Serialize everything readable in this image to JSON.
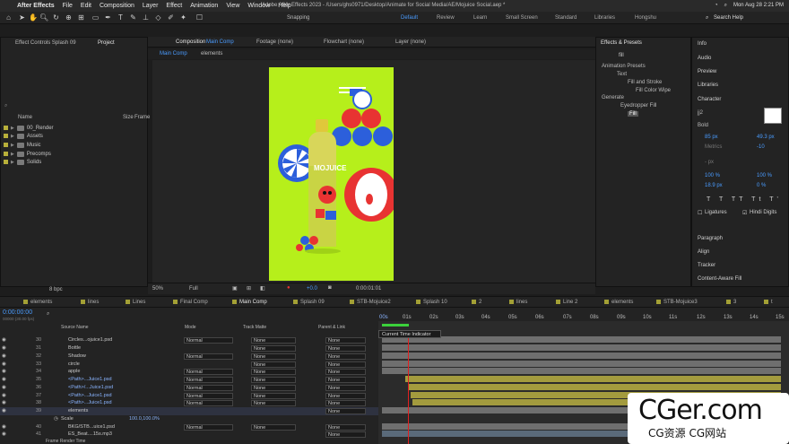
{
  "menubar": {
    "app": "After Effects",
    "items": [
      "File",
      "Edit",
      "Composition",
      "Layer",
      "Effect",
      "Animation",
      "View",
      "Window",
      "Help"
    ],
    "window_title": "Adobe After Effects 2023 - /Users/ghs0971/Desktop/Animate for Social Media/AE/Mojuice Social.aep *",
    "datetime": "Mon Aug 28  2:21 PM"
  },
  "toolbar": {
    "snapping": "Snapping",
    "workspaces": [
      "Default",
      "Review",
      "Learn",
      "Small Screen",
      "Standard",
      "Libraries",
      "Hongshu"
    ],
    "active_workspace": "Default",
    "search_help": "Search Help"
  },
  "project_panel": {
    "tab_effect_controls": "Effect Controls Splash 09",
    "tab_project": "Project",
    "col_name": "Name",
    "col_size": "Size",
    "col_frame": "Frame",
    "items": [
      {
        "name": "00_Render"
      },
      {
        "name": "Assets"
      },
      {
        "name": "Music"
      },
      {
        "name": "Precomps"
      },
      {
        "name": "Solids"
      }
    ],
    "bpc": "8 bpc"
  },
  "viewer": {
    "tab_composition": "Composition",
    "comp_name": "Main Comp",
    "tab_footage": "Footage (none)",
    "tab_flowchart": "Flowchart (none)",
    "tab_layer": "Layer (none)",
    "breadcrumbs": [
      "Main Comp",
      "elements"
    ],
    "zoom": "50%",
    "resolution": "Full",
    "exposure": "+0.0",
    "timecode": "0:00:01:01",
    "product_label": "MOJUICE"
  },
  "effects_panel": {
    "title": "Effects & Presets",
    "search": "fill",
    "tree": [
      "Animation Presets",
      "Text",
      "Fill and Stroke",
      "Fill Color Wipe",
      "Generate",
      "Eyedropper Fill",
      "Fill"
    ]
  },
  "right_panels": {
    "items": [
      "Info",
      "Audio",
      "Preview",
      "Libraries",
      "Character",
      "Paragraph",
      "Align",
      "Tracker",
      "Content-Aware Fill"
    ],
    "font": "jj2",
    "style": "Bold",
    "size": "85 px",
    "leading": "49.3 px",
    "tracking": "-10",
    "scale_v": "100 %",
    "scale_h": "100 %",
    "baseline": "18.9 px",
    "tsume": "0 %",
    "ligatures": "Ligatures",
    "hindi_digits": "Hindi Digits",
    "metrics": "Metrics",
    "unit_px": "- px"
  },
  "timeline": {
    "tabs": [
      "elements",
      "lines",
      "Lines",
      "Final Comp",
      "Main Comp",
      "Splash 09",
      "STB-Mojuice2",
      "Splash 10",
      "2",
      "lines",
      "Line 2",
      "elements",
      "STB-Mojuice3",
      "3",
      "t"
    ],
    "active_tab": "Main Comp",
    "current_time": "0:00:00:00",
    "fps": "00000 (30.00 fps)",
    "columns": {
      "source_name": "Source Name",
      "mode": "Mode",
      "track_matte": "Track Matte",
      "parent": "Parent & Link"
    },
    "ruler": [
      "00s",
      "01s",
      "02s",
      "03s",
      "04s",
      "05s",
      "06s",
      "07s",
      "08s",
      "09s",
      "10s",
      "11s",
      "12s",
      "13s",
      "14s",
      "15s"
    ],
    "tooltip": "Current Time Indicator",
    "frame_render_time": "Frame Render Time",
    "layers": [
      {
        "num": "30",
        "name": "Circles...ojuice1.psd",
        "mode": "Normal",
        "matte": "None",
        "parent": "None",
        "color": "#b8b03a"
      },
      {
        "num": "31",
        "name": "Bottle",
        "mode": "",
        "matte": "None",
        "parent": "None",
        "color": "#b8b03a"
      },
      {
        "num": "32",
        "name": "Shadow",
        "mode": "Normal",
        "matte": "None",
        "parent": "None",
        "color": "#b8b03a"
      },
      {
        "num": "33",
        "name": "circle",
        "mode": "",
        "matte": "None",
        "parent": "None",
        "color": "#b8b03a"
      },
      {
        "num": "34",
        "name": "apple",
        "mode": "Normal",
        "matte": "None",
        "parent": "None",
        "color": "#b8b03a"
      },
      {
        "num": "35",
        "name": "<Path>...Juice1.psd",
        "mode": "Normal",
        "matte": "None",
        "parent": "None",
        "color": "#e2d24a"
      },
      {
        "num": "36",
        "name": "<Path>/...Juice1.psd",
        "mode": "Normal",
        "matte": "None",
        "parent": "None",
        "color": "#e2d24a"
      },
      {
        "num": "37",
        "name": "<Path>...Juice1.psd",
        "mode": "Normal",
        "matte": "None",
        "parent": "None",
        "color": "#e2d24a"
      },
      {
        "num": "38",
        "name": "<Path>...Juice1.psd",
        "mode": "Normal",
        "matte": "None",
        "parent": "None",
        "color": "#e2d24a"
      },
      {
        "num": "39",
        "name": "elements",
        "mode": "",
        "matte": "",
        "parent": "None",
        "color": "#b8b03a"
      },
      {
        "num": "",
        "name": "Scale",
        "mode": "",
        "matte": "",
        "parent": "",
        "color": ""
      },
      {
        "num": "40",
        "name": "BKG/STB...uice1.psd",
        "mode": "Normal",
        "matte": "None",
        "parent": "None",
        "color": "#b8b03a"
      },
      {
        "num": "41",
        "name": "ES_Beat....15s.mp3",
        "mode": "",
        "matte": "",
        "parent": "None",
        "color": "#b8b03a"
      }
    ],
    "scale_value": "100.0,100.0%"
  },
  "watermark": {
    "brand": "CGer.com",
    "sub": "CG资源 CG网站"
  }
}
